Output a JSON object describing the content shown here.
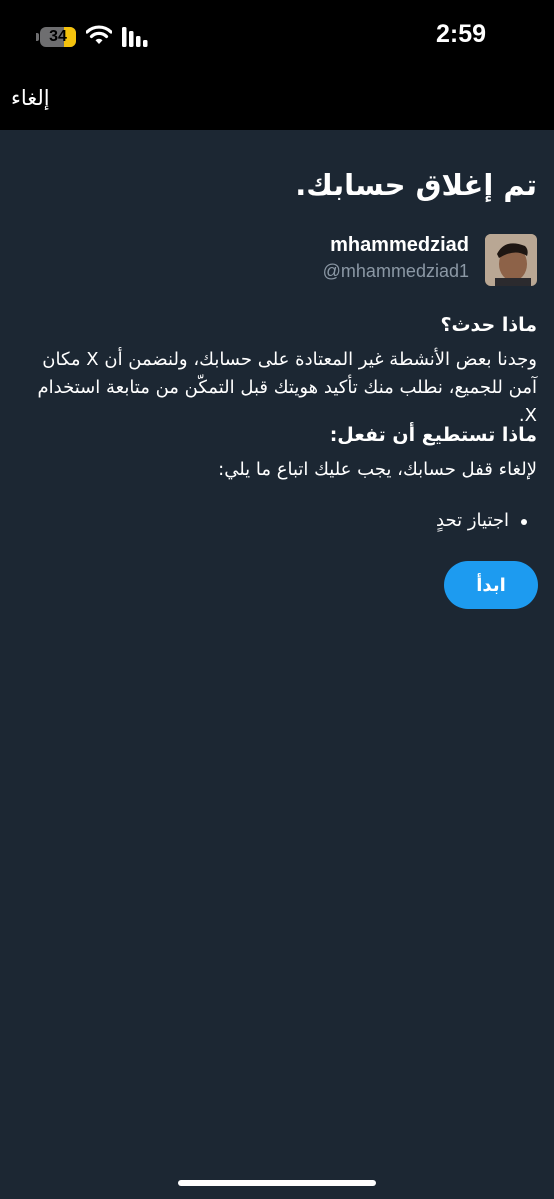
{
  "status_bar": {
    "battery_level": "34",
    "time": "2:59",
    "icons": [
      "battery-icon",
      "wifi-icon",
      "signal-icon"
    ]
  },
  "nav": {
    "cancel_label": "إلغاء"
  },
  "page": {
    "title": "تم إغلاق حسابك.",
    "account": {
      "display_name": "mhammedziad",
      "handle": "@mhammedziad1",
      "avatar": "avatar-photo"
    },
    "what_happened": {
      "title": "ماذا حدث؟",
      "body": "وجدنا بعض الأنشطة غير المعتادة على حسابك، ولنضمن أن X مكان آمن للجميع، نطلب منك تأكيد هويتك قبل التمكّن من متابعة استخدام X."
    },
    "what_you_can_do": {
      "title": "ماذا تستطيع أن تفعل:",
      "body": "لإلغاء قفل حسابك، يجب عليك اتباع ما يلي:",
      "steps": [
        "اجتياز تحدٍ"
      ]
    },
    "start_button_label": "ابدأ"
  },
  "colors": {
    "background": "#1c2733",
    "bar": "#000000",
    "accent": "#1d9bf0",
    "secondary_text": "#8b98a5",
    "battery_fill": "#f4c20d"
  }
}
